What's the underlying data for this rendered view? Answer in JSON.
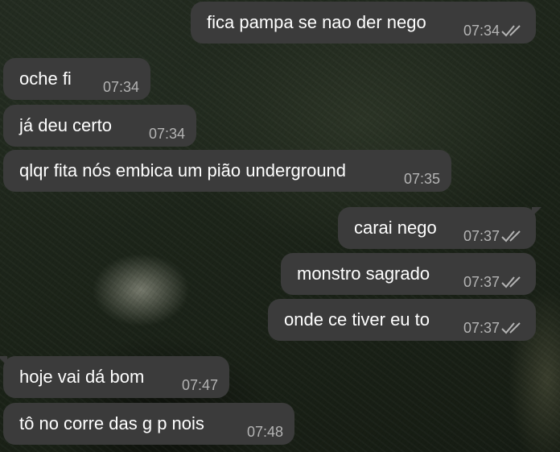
{
  "messages": [
    {
      "direction": "out",
      "text": "fica pampa se nao der nego",
      "time": "07:34",
      "status_icon": "double-check-icon"
    },
    {
      "direction": "in",
      "text": "oche fi",
      "time": "07:34"
    },
    {
      "direction": "in",
      "text": "já deu certo",
      "time": "07:34"
    },
    {
      "direction": "in",
      "text": "qlqr fita nós embica um pião underground",
      "time": "07:35"
    },
    {
      "direction": "out",
      "text": "carai nego",
      "time": "07:37",
      "status_icon": "double-check-icon"
    },
    {
      "direction": "out",
      "text": "monstro sagrado",
      "time": "07:37",
      "status_icon": "double-check-icon"
    },
    {
      "direction": "out",
      "text": "onde ce tiver eu to",
      "time": "07:37",
      "status_icon": "double-check-icon"
    },
    {
      "direction": "in",
      "text": "hoje vai dá bom",
      "time": "07:47"
    },
    {
      "direction": "in",
      "text": "tô no corre das g p nois",
      "time": "07:48"
    }
  ],
  "colors": {
    "bubble": "#3b3b3b",
    "text": "#ffffff",
    "time": "#b4b4b4",
    "check": "#b4b4b4"
  }
}
